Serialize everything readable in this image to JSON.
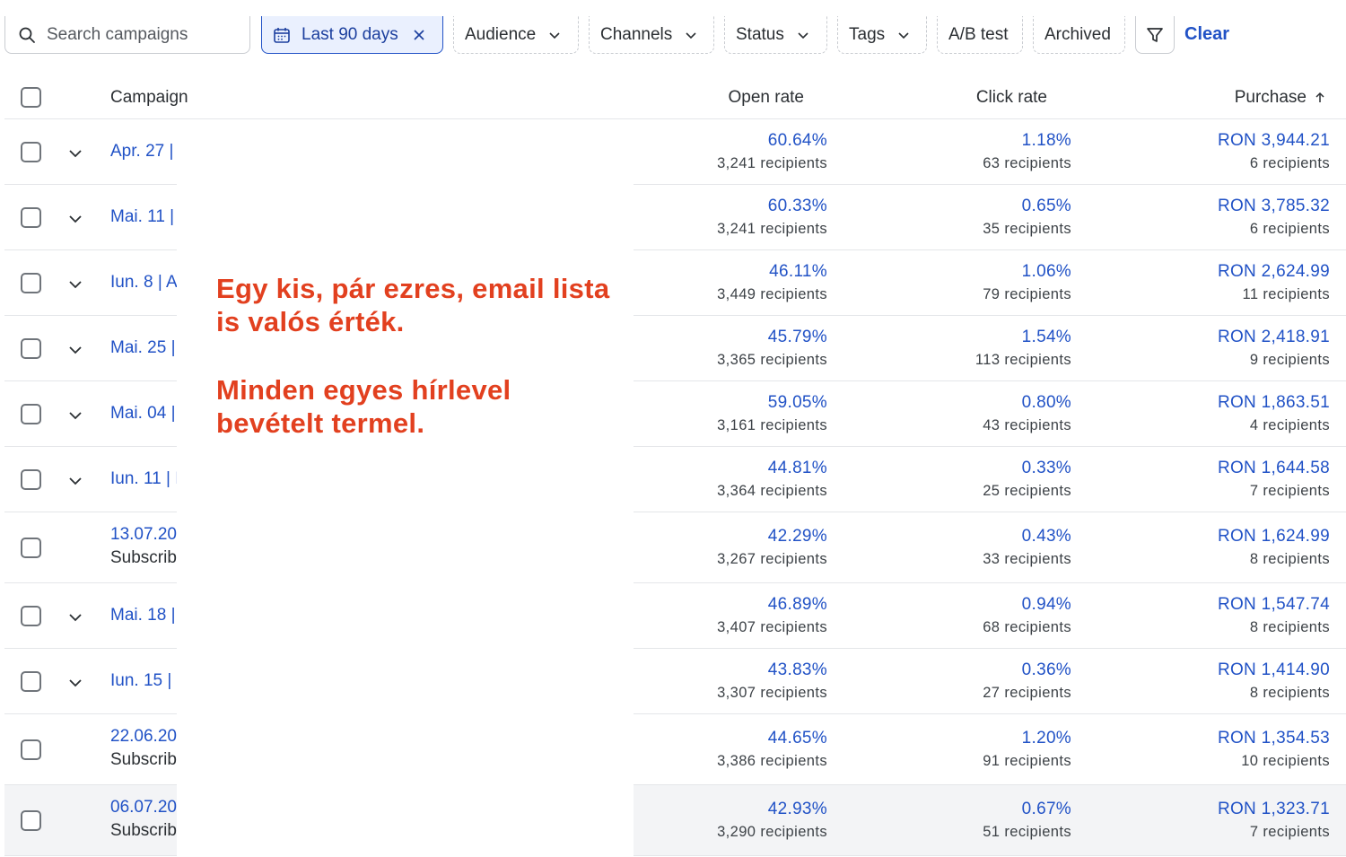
{
  "search": {
    "placeholder": "Search campaigns"
  },
  "filters": {
    "date_chip": "Last 90 days",
    "chips": [
      "Audience",
      "Channels",
      "Status",
      "Tags",
      "A/B test",
      "Archived"
    ],
    "clear_label": "Clear"
  },
  "table": {
    "headers": {
      "campaign": "Campaign",
      "open_rate": "Open rate",
      "click_rate": "Click rate",
      "purchase": "Purchase"
    },
    "rows": [
      {
        "campaign": "Apr. 27 |",
        "subline": "",
        "open_rate": "60.64%",
        "open_recipients": "3,241 recipients",
        "click_rate": "1.18%",
        "click_recipients": "63 recipients",
        "purchase": "RON 3,944.21",
        "purchase_recipients": "6 recipients"
      },
      {
        "campaign": "Mai. 11 |",
        "subline": "",
        "open_rate": "60.33%",
        "open_recipients": "3,241 recipients",
        "click_rate": "0.65%",
        "click_recipients": "35 recipients",
        "purchase": "RON 3,785.32",
        "purchase_recipients": "6 recipients"
      },
      {
        "campaign": "Iun. 8 | A",
        "subline": "",
        "open_rate": "46.11%",
        "open_recipients": "3,449 recipients",
        "click_rate": "1.06%",
        "click_recipients": "79 recipients",
        "purchase": "RON 2,624.99",
        "purchase_recipients": "11 recipients"
      },
      {
        "campaign": "Mai. 25 |",
        "subline": "",
        "open_rate": "45.79%",
        "open_recipients": "3,365 recipients",
        "click_rate": "1.54%",
        "click_recipients": "113 recipients",
        "purchase": "RON 2,418.91",
        "purchase_recipients": "9 recipients"
      },
      {
        "campaign": "Mai. 04 |",
        "subline": "",
        "open_rate": "59.05%",
        "open_recipients": "3,161 recipients",
        "click_rate": "0.80%",
        "click_recipients": "43 recipients",
        "purchase": "RON 1,863.51",
        "purchase_recipients": "4 recipients"
      },
      {
        "campaign": "Iun. 11 | I",
        "subline": "",
        "open_rate": "44.81%",
        "open_recipients": "3,364 recipients",
        "click_rate": "0.33%",
        "click_recipients": "25 recipients",
        "purchase": "RON 1,644.58",
        "purchase_recipients": "7 recipients"
      },
      {
        "campaign": "13.07.20",
        "subline": "Subscrib",
        "open_rate": "42.29%",
        "open_recipients": "3,267 recipients",
        "click_rate": "0.43%",
        "click_recipients": "33 recipients",
        "purchase": "RON 1,624.99",
        "purchase_recipients": "8 recipients"
      },
      {
        "campaign": "Mai. 18 |",
        "subline": "",
        "open_rate": "46.89%",
        "open_recipients": "3,407 recipients",
        "click_rate": "0.94%",
        "click_recipients": "68 recipients",
        "purchase": "RON 1,547.74",
        "purchase_recipients": "8 recipients"
      },
      {
        "campaign": "Iun. 15 |",
        "subline": "",
        "open_rate": "43.83%",
        "open_recipients": "3,307 recipients",
        "click_rate": "0.36%",
        "click_recipients": "27 recipients",
        "purchase": "RON 1,414.90",
        "purchase_recipients": "8 recipients"
      },
      {
        "campaign": "22.06.20",
        "subline": "Subscrib",
        "open_rate": "44.65%",
        "open_recipients": "3,386 recipients",
        "click_rate": "1.20%",
        "click_recipients": "91 recipients",
        "purchase": "RON 1,354.53",
        "purchase_recipients": "10 recipients"
      },
      {
        "campaign": "06.07.20",
        "subline": "Subscrib",
        "open_rate": "42.93%",
        "open_recipients": "3,290 recipients",
        "click_rate": "0.67%",
        "click_recipients": "51 recipients",
        "purchase": "RON 1,323.71",
        "purchase_recipients": "7 recipients"
      }
    ]
  },
  "annotation": {
    "line1": "Egy kis, pár ezres, email lista",
    "line2": "is valós érték.",
    "line3": "Minden egyes hírlevel",
    "line4": "bevételt termel."
  },
  "colors": {
    "accent": "#2152c6",
    "annotation": "#e2401f",
    "border": "#e4e6e9"
  }
}
